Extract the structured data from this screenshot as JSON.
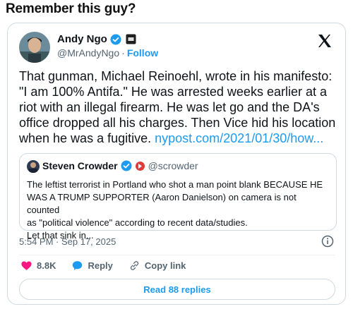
{
  "headline": "Remember this guy?",
  "tweet": {
    "author": {
      "name": "Andy Ngo",
      "handle": "@MrAndyNgo",
      "separator": "·",
      "follow_label": "Follow"
    },
    "text": "That gunman, Michael Reinoehl, wrote in his manifesto: \"I am 100% Antifa.\" He was arrested weeks earlier at a riot with an illegal firearm. He was let go and the DA's office dropped all his charges. Then Vice hid his location when he was a fugitive. ",
    "link_text": "nypost.com/2021/01/30/how...",
    "quote": {
      "name": "Steven Crowder",
      "handle": "@scrowder",
      "text_lines": [
        "The leftist terrorist in Portland who shot a man point blank BECAUSE HE",
        "WAS A TRUMP SUPPORTER (Aaron Danielson) on camera is not counted",
        "as \"political violence\" according to recent data/studies.",
        "Let that sink in..."
      ]
    },
    "timestamp": "5:54 PM · Sep 17, 2025",
    "actions": {
      "likes": "8.8K",
      "reply_label": "Reply",
      "copy_label": "Copy link"
    },
    "replies_button": "Read 88 replies"
  },
  "colors": {
    "accent": "#1d9bf0",
    "like": "#f91880",
    "muted": "#536471",
    "border": "#cfd9de"
  },
  "icons": [
    "verified-badge-icon",
    "pm-badge-icon",
    "x-logo-icon",
    "info-icon",
    "heart-icon",
    "reply-bubble-icon",
    "link-icon",
    "flag-emoji-icon"
  ]
}
